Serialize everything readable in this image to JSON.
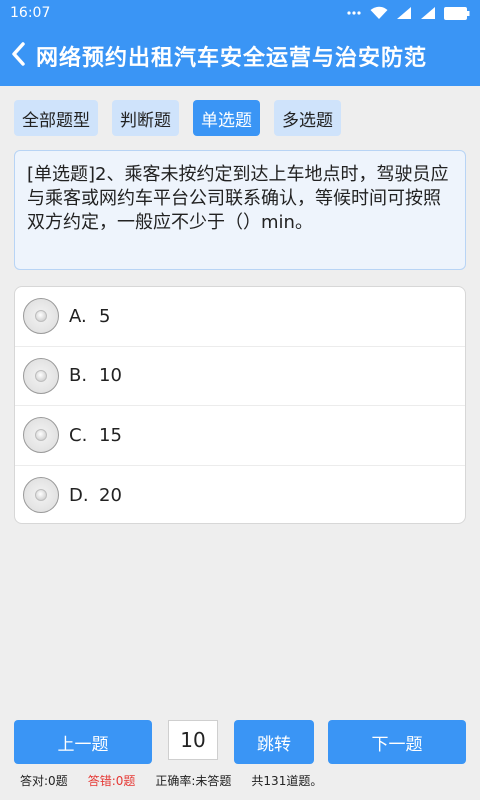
{
  "status": {
    "time": "16:07"
  },
  "header": {
    "title": "网络预约出租汽车安全运营与治安防范",
    "back_icon": "chevron-left-icon"
  },
  "tabs": [
    {
      "label": "全部题型",
      "active": false
    },
    {
      "label": "判断题",
      "active": false
    },
    {
      "label": "单选题",
      "active": true
    },
    {
      "label": "多选题",
      "active": false
    }
  ],
  "question": {
    "text": "[单选题]2、乘客未按约定到达上车地点时，驾驶员应与乘客或网约车平台公司联系确认，等候时间可按照双方约定，一般应不少于（）min。"
  },
  "options": [
    {
      "letter": "A.",
      "text": "5"
    },
    {
      "letter": "B.",
      "text": "10"
    },
    {
      "letter": "C.",
      "text": "15"
    },
    {
      "letter": "D.",
      "text": "20"
    }
  ],
  "nav": {
    "prev_label": "上一题",
    "page_value": "10",
    "jump_label": "跳转",
    "next_label": "下一题"
  },
  "stats": {
    "correct": "答对:0题",
    "wrong": "答错:0题",
    "rate": "正确率:未答题",
    "total": "共131道题。"
  },
  "colors": {
    "primary": "#3a95f5",
    "tab_bg": "#cfe3fb",
    "wrong": "#e53935"
  }
}
